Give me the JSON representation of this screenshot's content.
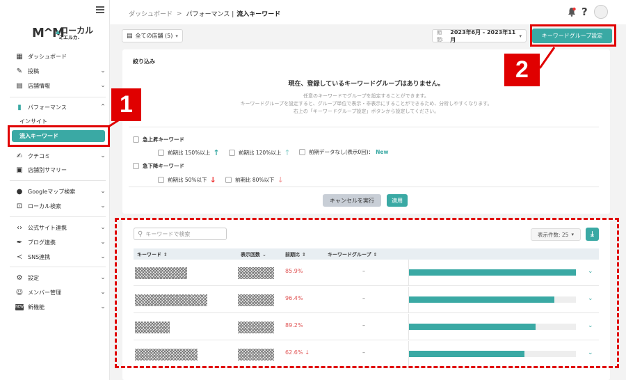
{
  "sidebar": {
    "logo_mark": "M^M",
    "logo_line1": "ローカル",
    "logo_line2": "ミエルカ.",
    "items": [
      {
        "label": "ダッシュボード"
      },
      {
        "label": "投稿"
      },
      {
        "label": "店舗情報"
      },
      {
        "label": "パフォーマンス"
      },
      {
        "label": "クチコミ"
      },
      {
        "label": "店舗別サマリー"
      },
      {
        "label": "Googleマップ検索"
      },
      {
        "label": "ローカル検索"
      },
      {
        "label": "公式サイト連携"
      },
      {
        "label": "ブログ連携"
      },
      {
        "label": "SNS連携"
      },
      {
        "label": "設定"
      },
      {
        "label": "メンバー管理"
      },
      {
        "label": "新機能"
      }
    ],
    "sub_insight": "インサイト",
    "sub_active": "流入キーワード"
  },
  "callouts": {
    "one": "1",
    "two": "2"
  },
  "topbar": {
    "breadcrumb_home": "ダッシュボード",
    "breadcrumb_sep": ">",
    "breadcrumb_mid": "パフォーマンス |",
    "breadcrumb_current": "流入キーワード",
    "help": "?"
  },
  "toolbar": {
    "store_select": "全ての店舗 (5)",
    "period_label": "期間:",
    "period_value": "2023年6月 - 2023年11月",
    "kw_group_button": "キーワードグループ設定"
  },
  "filter": {
    "title": "絞り込み",
    "empty_title": "現在、登録しているキーワードグループはありません。",
    "help_lines": [
      "任意のキーワードでグループを設定することができます。",
      "キーワードグループを設定すると、グループ単位で表示・非表示にすることができるため、分析しやすくなります。",
      "右上の「キーワードグループ設定」ボタンから設定してください。"
    ],
    "rising_label": "急上昇キーワード",
    "rising_150": "前期比 150%以上",
    "rising_120": "前期比 120%以上",
    "no_prev": "前期データなし(表示0回)：",
    "new_tag": "New",
    "falling_label": "急下降キーワード",
    "falling_50": "前期比 50%以下",
    "falling_80": "前期比 80%以下",
    "cancel_button": "キャンセルを実行",
    "apply_button": "適用"
  },
  "table": {
    "search_placeholder": "キーワードで検索",
    "per_page": "表示件数: 25",
    "headers": {
      "keyword": "キーワード",
      "views": "表示回数",
      "prev_ratio": "前期比",
      "group": "キーワードグループ"
    },
    "rows": [
      {
        "pct": "85.9%",
        "trend": "",
        "group": "–",
        "bar_fraction": 1.0
      },
      {
        "pct": "96.4%",
        "trend": "",
        "group": "–",
        "bar_fraction": 0.87
      },
      {
        "pct": "89.2%",
        "trend": "",
        "group": "–",
        "bar_fraction": 0.76
      },
      {
        "pct": "62.6%",
        "trend": "↓",
        "group": "–",
        "bar_fraction": 0.69
      }
    ]
  },
  "colors": {
    "accent": "#3aa9a4",
    "callout": "#e00000",
    "negative": "#e05555"
  }
}
